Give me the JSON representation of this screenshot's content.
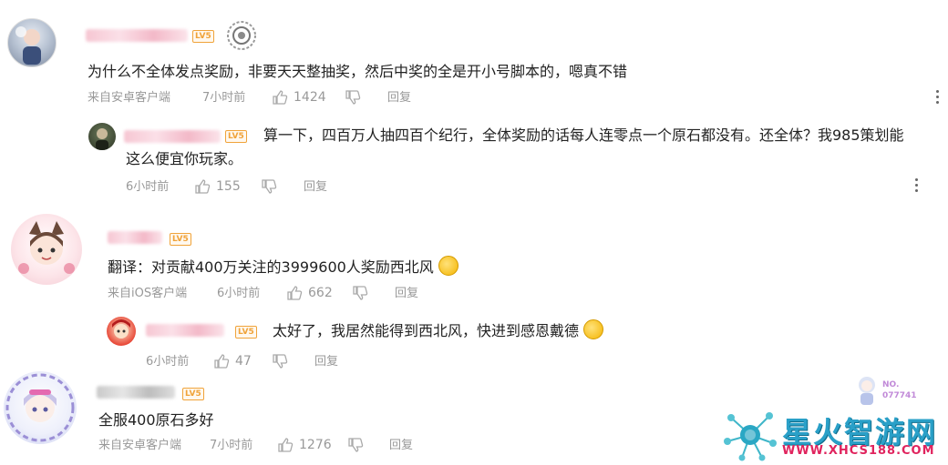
{
  "comments": [
    {
      "level": "LV5",
      "text": "为什么不全体发点奖励，非要天天整抽奖，然后中奖的全是开小号脚本的，嗯真不错",
      "source": "来自安卓客户端",
      "time": "7小时前",
      "likes": "1424",
      "reply_label": "回复",
      "reply": {
        "level": "LV5",
        "text_line1": "算一下，四百万人抽四百个纪行，全体奖励的话每人连零点一个原石都没有。还全体？我985策划能",
        "text_line2": "这么便宜你玩家。",
        "time": "6小时前",
        "likes": "155",
        "reply_label": "回复"
      }
    },
    {
      "level": "LV5",
      "text": "翻译：对贡献400万关注的3999600人奖励西北风",
      "source": "来自iOS客户端",
      "time": "6小时前",
      "likes": "662",
      "reply_label": "回复",
      "reply": {
        "level": "LV5",
        "text": "太好了，我居然能得到西北风，快进到感恩戴德",
        "time": "6小时前",
        "likes": "47",
        "reply_label": "回复"
      }
    },
    {
      "level": "LV5",
      "text": "全服400原石多好",
      "source": "来自安卓客户端",
      "time": "7小时前",
      "likes": "1276",
      "reply_label": "回复"
    }
  ],
  "watermark": {
    "site_name": "星火智游网",
    "url": "WWW.XHCS188.COM",
    "badge_no": "NO.",
    "badge_num": "077741"
  }
}
